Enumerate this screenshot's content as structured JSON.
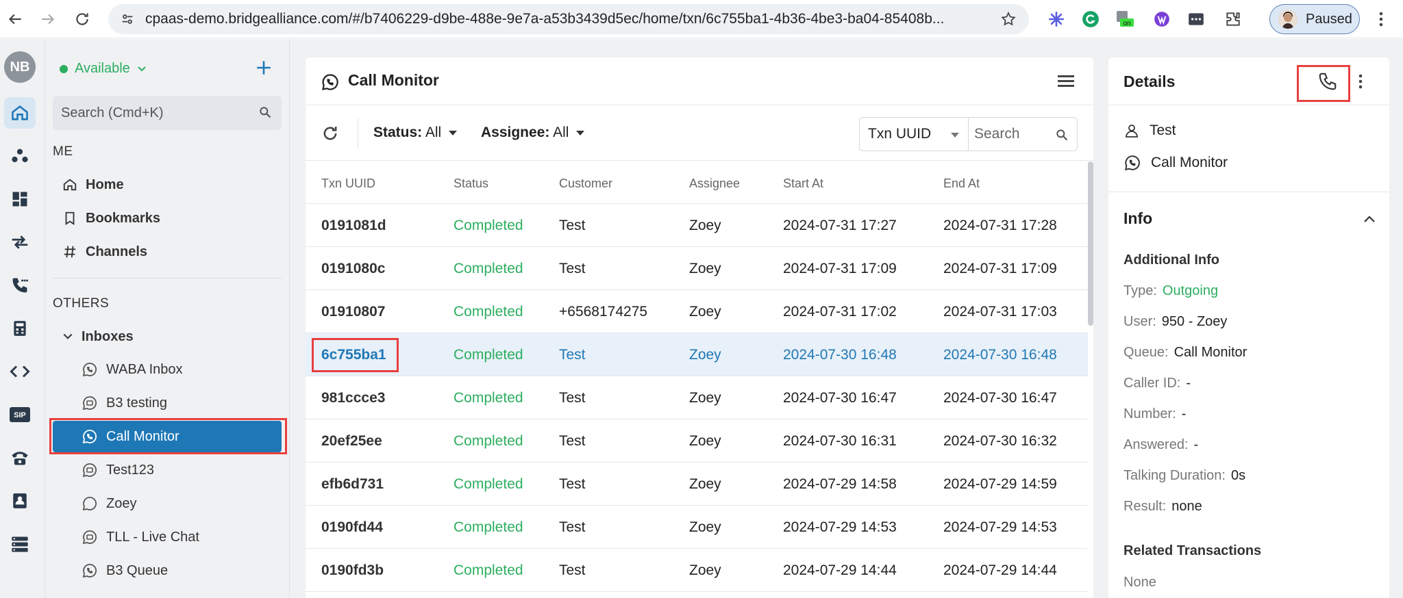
{
  "browser": {
    "url": "cpaas-demo.bridgealliance.com/#/b7406229-d9be-488e-9e7a-a53b3439d5ec/home/txn/6c755ba1-4b36-4be3-ba04-85408b...",
    "profile_label": "Paused",
    "extension_badge": "on"
  },
  "rail": {
    "avatar_initials": "NB",
    "sip_label": "SIP"
  },
  "sidebar": {
    "status": "Available",
    "search_placeholder": "Search (Cmd+K)",
    "me_label": "ME",
    "me_items": [
      {
        "label": "Home"
      },
      {
        "label": "Bookmarks"
      },
      {
        "label": "Channels"
      }
    ],
    "others_label": "OTHERS",
    "inboxes_label": "Inboxes",
    "inboxes": [
      {
        "label": "WABA Inbox"
      },
      {
        "label": "B3 testing"
      },
      {
        "label": "Call Monitor"
      },
      {
        "label": "Test123"
      },
      {
        "label": "Zoey"
      },
      {
        "label": "TLL - Live Chat"
      },
      {
        "label": "B3 Queue"
      }
    ]
  },
  "main": {
    "title": "Call Monitor",
    "filters": {
      "status_label": "Status:",
      "status_value": "All",
      "assignee_label": "Assignee:",
      "assignee_value": "All",
      "search_field": "Txn UUID",
      "search_placeholder": "Search"
    },
    "columns": [
      "Txn UUID",
      "Status",
      "Customer",
      "Assignee",
      "Start At",
      "End At"
    ],
    "rows": [
      {
        "uuid": "0191081d",
        "status": "Completed",
        "customer": "Test",
        "assignee": "Zoey",
        "start": "2024-07-31 17:27",
        "end": "2024-07-31 17:28"
      },
      {
        "uuid": "0191080c",
        "status": "Completed",
        "customer": "Test",
        "assignee": "Zoey",
        "start": "2024-07-31 17:09",
        "end": "2024-07-31 17:09"
      },
      {
        "uuid": "01910807",
        "status": "Completed",
        "customer": "+6568174275",
        "assignee": "Zoey",
        "start": "2024-07-31 17:02",
        "end": "2024-07-31 17:03"
      },
      {
        "uuid": "6c755ba1",
        "status": "Completed",
        "customer": "Test",
        "assignee": "Zoey",
        "start": "2024-07-30 16:48",
        "end": "2024-07-30 16:48"
      },
      {
        "uuid": "981ccce3",
        "status": "Completed",
        "customer": "Test",
        "assignee": "Zoey",
        "start": "2024-07-30 16:47",
        "end": "2024-07-30 16:47"
      },
      {
        "uuid": "20ef25ee",
        "status": "Completed",
        "customer": "Test",
        "assignee": "Zoey",
        "start": "2024-07-30 16:31",
        "end": "2024-07-30 16:32"
      },
      {
        "uuid": "efb6d731",
        "status": "Completed",
        "customer": "Test",
        "assignee": "Zoey",
        "start": "2024-07-29 14:58",
        "end": "2024-07-29 14:59"
      },
      {
        "uuid": "0190fd44",
        "status": "Completed",
        "customer": "Test",
        "assignee": "Zoey",
        "start": "2024-07-29 14:53",
        "end": "2024-07-29 14:53"
      },
      {
        "uuid": "0190fd3b",
        "status": "Completed",
        "customer": "Test",
        "assignee": "Zoey",
        "start": "2024-07-29 14:44",
        "end": "2024-07-29 14:44"
      }
    ]
  },
  "details": {
    "title": "Details",
    "customer": "Test",
    "inbox": "Call Monitor",
    "info_title": "Info",
    "additional_title": "Additional Info",
    "fields": [
      {
        "key": "Type:",
        "value": "Outgoing"
      },
      {
        "key": "User:",
        "value": "950 - Zoey"
      },
      {
        "key": "Queue:",
        "value": "Call Monitor"
      },
      {
        "key": "Caller ID:",
        "value": "-"
      },
      {
        "key": "Number:",
        "value": "-"
      },
      {
        "key": "Answered:",
        "value": "-"
      },
      {
        "key": "Talking Duration:",
        "value": "0s"
      },
      {
        "key": "Result:",
        "value": "none"
      }
    ],
    "related_title": "Related Transactions",
    "related_value": "None"
  },
  "colors": {
    "accent": "#1f78b6",
    "success": "#2cae5f",
    "highlight": "#e8403f",
    "selected_row": "#e8f0f9"
  }
}
